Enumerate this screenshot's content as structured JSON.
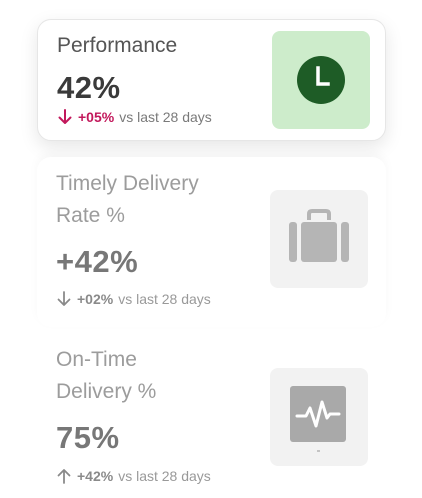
{
  "cards": [
    {
      "title": "Performance",
      "value": "42%",
      "delta_direction": "down",
      "delta_pct": "+05%",
      "delta_text": "vs last 28 days",
      "icon": "clock-icon",
      "accent": "#c2185b",
      "icon_bg": "#cdeccb",
      "icon_fg": "#1e5c26"
    },
    {
      "title_line1": "Timely Delivery",
      "title_line2": "Rate %",
      "value": "+42%",
      "delta_direction": "down",
      "delta_pct": "+02%",
      "delta_text": "vs last 28 days",
      "icon": "briefcase-icon"
    },
    {
      "title_line1": "On-Time",
      "title_line2": "Delivery %",
      "value": "75%",
      "delta_direction": "up",
      "delta_pct": "+42%",
      "delta_text": "vs last 28 days",
      "icon": "activity-monitor-icon"
    }
  ]
}
